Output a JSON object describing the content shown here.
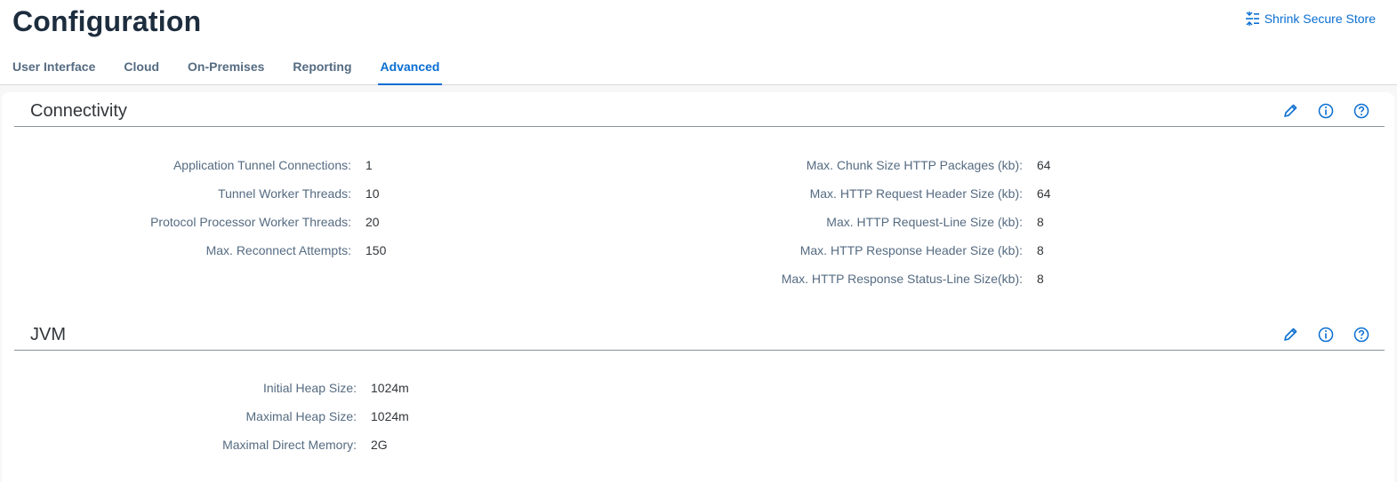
{
  "header": {
    "title": "Configuration",
    "shrink_label": "Shrink Secure Store"
  },
  "tabs": [
    {
      "label": "User Interface",
      "active": false
    },
    {
      "label": "Cloud",
      "active": false
    },
    {
      "label": "On-Premises",
      "active": false
    },
    {
      "label": "Reporting",
      "active": false
    },
    {
      "label": "Advanced",
      "active": true
    }
  ],
  "colors": {
    "accent": "#0a6ed1",
    "title": "#1d2d3e",
    "label": "#556b82",
    "text": "#32363a"
  },
  "connectivity": {
    "title": "Connectivity",
    "icons": [
      "edit-icon",
      "info-icon",
      "help-icon"
    ],
    "left": [
      {
        "label": "Application Tunnel Connections:",
        "value": "1"
      },
      {
        "label": "Tunnel Worker Threads:",
        "value": "10"
      },
      {
        "label": "Protocol Processor Worker Threads:",
        "value": "20"
      },
      {
        "label": "Max. Reconnect Attempts:",
        "value": "150"
      }
    ],
    "right": [
      {
        "label": "Max. Chunk Size HTTP Packages (kb):",
        "value": "64"
      },
      {
        "label": "Max. HTTP Request Header Size (kb):",
        "value": "64"
      },
      {
        "label": "Max. HTTP Request-Line Size (kb):",
        "value": "8"
      },
      {
        "label": "Max. HTTP Response Header Size (kb):",
        "value": "8"
      },
      {
        "label": "Max. HTTP Response Status-Line Size(kb):",
        "value": "8"
      }
    ]
  },
  "jvm": {
    "title": "JVM",
    "icons": [
      "edit-icon",
      "info-icon",
      "help-icon"
    ],
    "left": [
      {
        "label": "Initial Heap Size:",
        "value": "1024m"
      },
      {
        "label": "Maximal Heap Size:",
        "value": "1024m"
      },
      {
        "label": "Maximal Direct Memory:",
        "value": "2G"
      }
    ]
  }
}
